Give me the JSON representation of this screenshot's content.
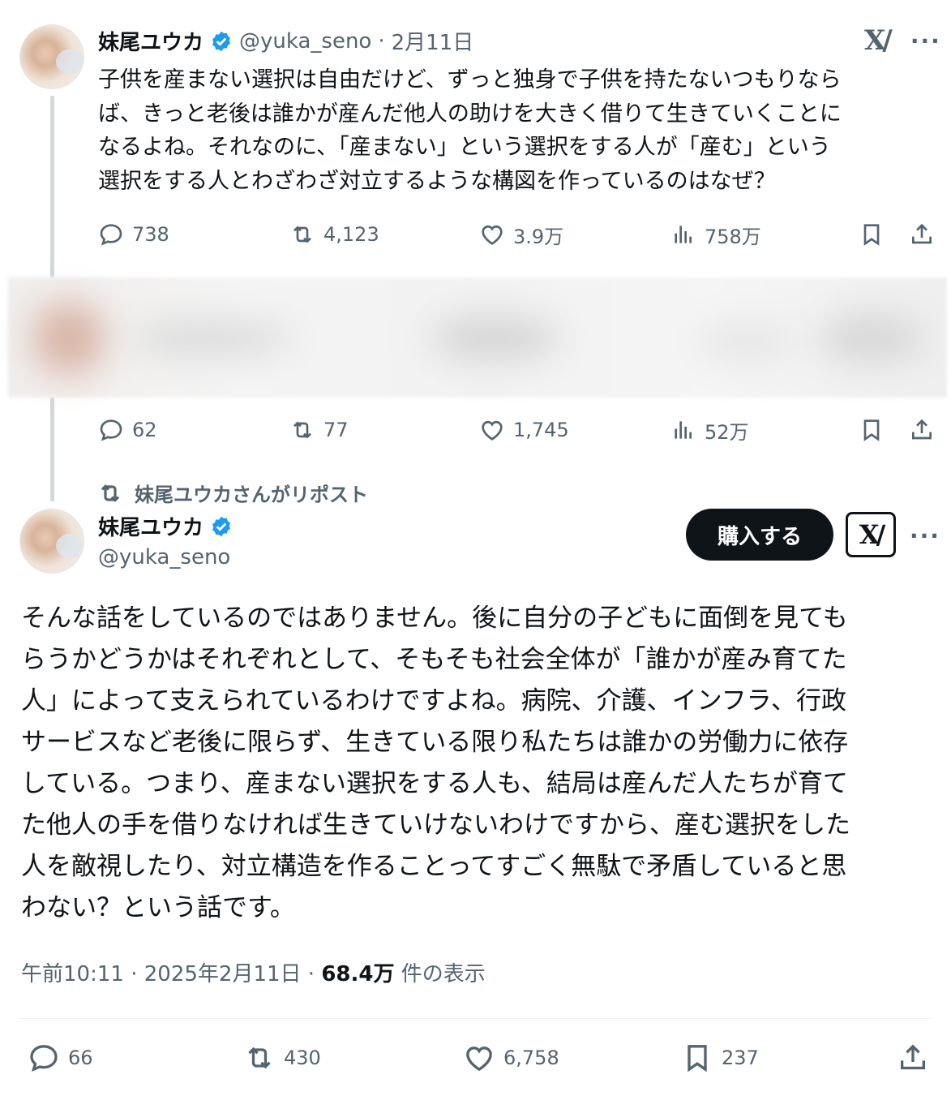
{
  "post1": {
    "name": "妹尾ユウカ",
    "handle": "@yuka_seno",
    "separator": "·",
    "date": "2月11日",
    "lines": [
      "子供を産まない選択は自由だけど、ずっと独身で子供を持たないつもりなら",
      "ば、きっと老後は誰かが産んだ他人の助けを大きく借りて生きていくことに",
      "なるよね。それなのに、「産まない」という選択をする人が「産む」という",
      "選択をする人とわざわざ対立するような構図を作っているのはなぜ？"
    ],
    "replies": "738",
    "reposts": "4,123",
    "likes": "3.9万",
    "views": "758万"
  },
  "post2": {
    "replies": "62",
    "reposts": "77",
    "likes": "1,745",
    "views": "52万"
  },
  "repost_label": "妹尾ユウカさんがリポスト",
  "main": {
    "name": "妹尾ユウカ",
    "handle": "@yuka_seno",
    "buy_label": "購入する",
    "lines": [
      "そんな話をしているのではありません。後に自分の子どもに面倒を見ても",
      "らうかどうかはそれぞれとして、そもそも社会全体が「誰かが産み育てた",
      "人」によって支えられているわけですよね。病院、介護、インフラ、行政",
      "サービスなど老後に限らず、生きている限り私たちは誰かの労働力に依存",
      "している。つまり、産まない選択をする人も、結局は産んだ人たちが育て",
      "た他人の手を借りなければ生きていけないわけですから、産む選択をした",
      "人を敵視したり、対立構造を作ることってすごく無駄で矛盾していると思",
      "わない？という話です。"
    ],
    "time": "午前10:11",
    "sep1": "·",
    "date": "2025年2月11日",
    "sep2": "·",
    "views_count": "68.4万",
    "views_label": "件の表示",
    "replies": "66",
    "reposts": "430",
    "likes": "6,758",
    "bookmarks": "237"
  },
  "icons": {
    "reply": "reply-icon",
    "repost": "repost-icon",
    "like": "heart-icon",
    "views": "views-icon",
    "bookmark": "bookmark-icon",
    "share": "share-icon",
    "grok": "grok-icon",
    "more": "more-icon",
    "verified": "verified-badge-icon"
  },
  "colors": {
    "text": "#0f1419",
    "muted": "#536471",
    "verified": "#1d9bf0",
    "button_bg": "#0f1419"
  }
}
